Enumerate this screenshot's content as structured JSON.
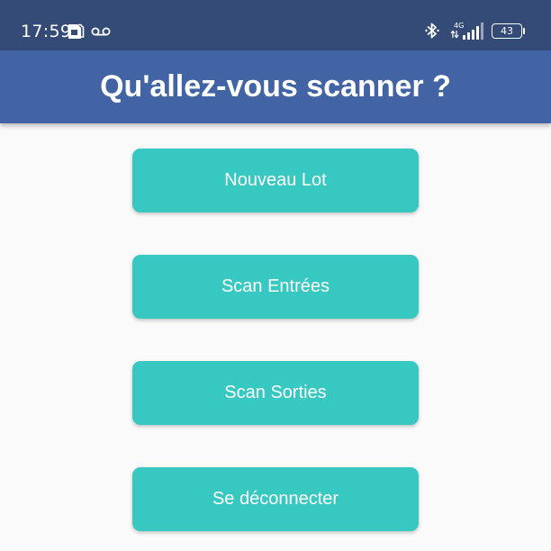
{
  "status_bar": {
    "time": "17:59",
    "network": "4G",
    "battery": "43",
    "icons": [
      "sim-card-icon",
      "voicemail-icon",
      "bluetooth-icon",
      "data-arrows-icon",
      "signal-strength-icon",
      "battery-icon"
    ]
  },
  "header": {
    "title": "Qu'allez-vous scanner ?"
  },
  "menu": {
    "new_batch": "Nouveau Lot",
    "scan_in": "Scan Entrées",
    "scan_out": "Scan Sorties",
    "logout": "Se déconnecter"
  },
  "colors": {
    "status_bar": "#354b77",
    "app_bar": "#4264a4",
    "button": "#38c8c2",
    "background": "#fafafa",
    "text": "#ffffff"
  }
}
